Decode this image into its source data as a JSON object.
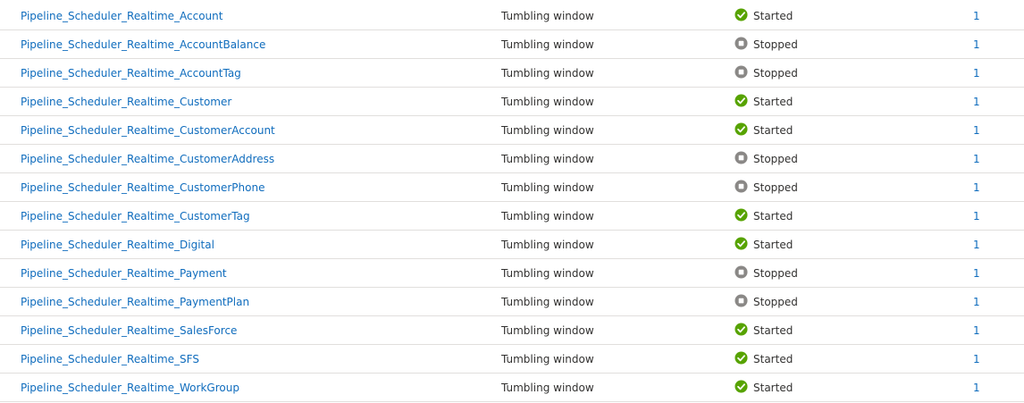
{
  "rows": [
    {
      "name": "Pipeline_Scheduler_Realtime_Account",
      "type": "Tumbling window",
      "status": "Started",
      "count": "1"
    },
    {
      "name": "Pipeline_Scheduler_Realtime_AccountBalance",
      "type": "Tumbling window",
      "status": "Stopped",
      "count": "1"
    },
    {
      "name": "Pipeline_Scheduler_Realtime_AccountTag",
      "type": "Tumbling window",
      "status": "Stopped",
      "count": "1"
    },
    {
      "name": "Pipeline_Scheduler_Realtime_Customer",
      "type": "Tumbling window",
      "status": "Started",
      "count": "1"
    },
    {
      "name": "Pipeline_Scheduler_Realtime_CustomerAccount",
      "type": "Tumbling window",
      "status": "Started",
      "count": "1"
    },
    {
      "name": "Pipeline_Scheduler_Realtime_CustomerAddress",
      "type": "Tumbling window",
      "status": "Stopped",
      "count": "1"
    },
    {
      "name": "Pipeline_Scheduler_Realtime_CustomerPhone",
      "type": "Tumbling window",
      "status": "Stopped",
      "count": "1"
    },
    {
      "name": "Pipeline_Scheduler_Realtime_CustomerTag",
      "type": "Tumbling window",
      "status": "Started",
      "count": "1"
    },
    {
      "name": "Pipeline_Scheduler_Realtime_Digital",
      "type": "Tumbling window",
      "status": "Started",
      "count": "1"
    },
    {
      "name": "Pipeline_Scheduler_Realtime_Payment",
      "type": "Tumbling window",
      "status": "Stopped",
      "count": "1"
    },
    {
      "name": "Pipeline_Scheduler_Realtime_PaymentPlan",
      "type": "Tumbling window",
      "status": "Stopped",
      "count": "1"
    },
    {
      "name": "Pipeline_Scheduler_Realtime_SalesForce",
      "type": "Tumbling window",
      "status": "Started",
      "count": "1"
    },
    {
      "name": "Pipeline_Scheduler_Realtime_SFS",
      "type": "Tumbling window",
      "status": "Started",
      "count": "1"
    },
    {
      "name": "Pipeline_Scheduler_Realtime_WorkGroup",
      "type": "Tumbling window",
      "status": "Started",
      "count": "1"
    }
  ],
  "status_icons": {
    "Started": "check-circle-icon",
    "Stopped": "stop-circle-icon"
  },
  "colors": {
    "link": "#0f6cbd",
    "started": "#57a300",
    "stopped": "#8a8886",
    "divider": "#e1dfdd"
  }
}
